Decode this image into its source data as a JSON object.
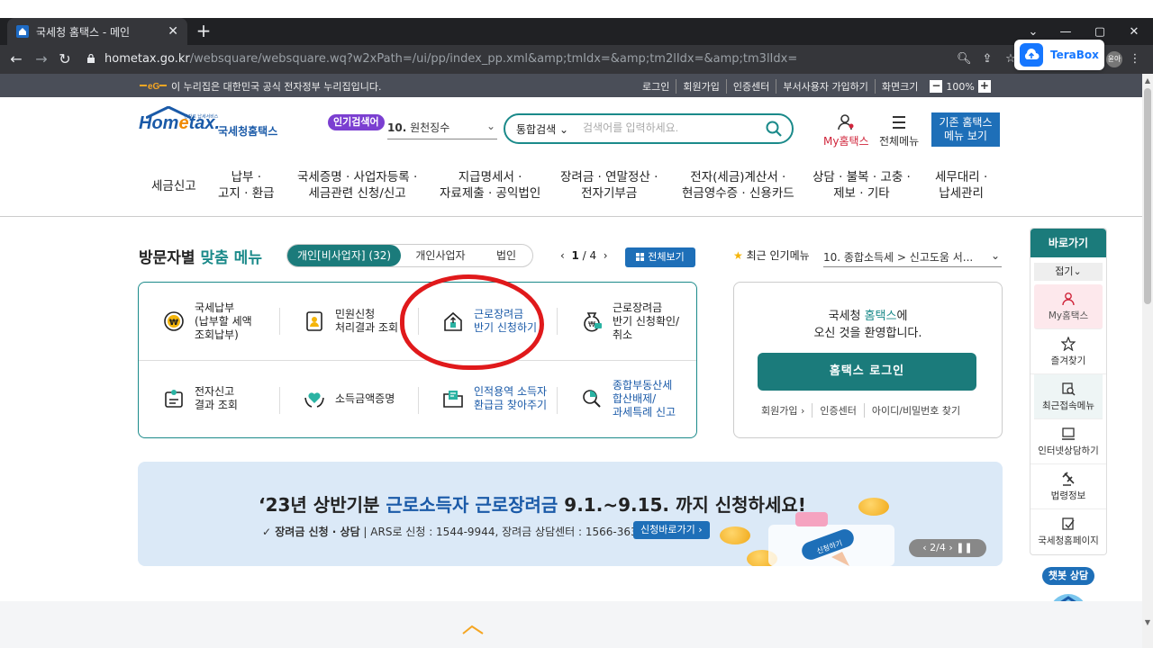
{
  "browser": {
    "tab_title": "국세청 홈택스 - 메인",
    "url_host": "hometax.go.kr",
    "url_path": "/websquare/websquare.wq?w2xPath=/ui/pp/index_pp.xml&amp;tmIdx=&amp;tm2lIdx=&amp;tm3lIdx=",
    "extension_label": "TeraBox",
    "profile_initials": "윤아"
  },
  "govbar": {
    "notice": "이 누리집은 대한민국 공식 전자정부 누리집입니다.",
    "links": [
      "로그인",
      "회원가입",
      "인증센터",
      "부서사용자 가입하기",
      "화면크기"
    ],
    "zoom": "100%",
    "zoom_minus": "−",
    "zoom_plus": "+"
  },
  "header": {
    "logo_tagline": "전자로 납세서비스",
    "logo_kr": "국세청홈택스",
    "popular_badge": "인기검색어",
    "popular_num": "10.",
    "popular_term": "원천징수",
    "search_scope": "통합검색",
    "search_placeholder": "검색어를 입력하세요.",
    "my_hometax": "My홈택스",
    "all_menu": "전체메뉴",
    "old_menu": "기존 홈택스\n메뉴 보기"
  },
  "gnb": [
    "세금신고",
    "납부 ·\n고지 · 환급",
    "국세증명 · 사업자등록 ·\n세금관련 신청/신고",
    "지급명세서 ·\n자료제출 · 공익법인",
    "장려금 · 연말정산 ·\n전자기부금",
    "전자(세금)계산서 ·\n현금영수증 · 신용카드",
    "상담 · 불복 · 고충 ·\n제보 · 기타",
    "세무대리 ·\n납세관리"
  ],
  "custom_menu": {
    "title_prefix": "방문자별",
    "title_accent": "맞춤 메뉴",
    "segments": [
      "개인[비사업자] (32)",
      "개인사업자",
      "법인"
    ],
    "page_current": "1",
    "page_total": "/ 4",
    "all_view": "전체보기",
    "items": [
      "국세납부\n(납부할 세액\n조회납부)",
      "민원신청\n처리결과 조회",
      "근로장려금\n반기 신청하기",
      "근로장려금\n반기 신청확인/\n취소",
      "전자신고\n결과 조회",
      "소득금액증명",
      "인적용역 소득자\n환급금 찾아주기",
      "종합부동산세\n합산배제/\n과세특례 신고"
    ]
  },
  "popular_menu": {
    "label": "최근 인기메뉴",
    "current": "10. 종합소득세 > 신고도움 서..."
  },
  "login_box": {
    "welcome_1": "국세청 ",
    "welcome_hl": "홈택스",
    "welcome_2": "에\n오신 것을 환영합니다.",
    "login_button": "홈택스 로그인",
    "links": [
      "회원가입 ›",
      "인증센터",
      "아이디/비밀번호 찾기"
    ]
  },
  "banner": {
    "title_1": "‘23년 상반기분 ",
    "title_hl": "근로소득자 근로장려금",
    "title_2": " 9.1.~9.15. 까지 신청하세요!",
    "sub_bold": "✓ 장려금 신청 · 상담",
    "sub_rest": " | ARS로 신청 : 1544-9944, 장려금 상담센터 : 1566-3636",
    "button": "신청바로가기 ›",
    "pager": "‹  2/4  ›  ❚❚",
    "phone_label": "신청하기"
  },
  "quick": {
    "title": "바로가기",
    "fold": "접기",
    "items": [
      "My홈택스",
      "즐겨찾기",
      "최근접속메뉴",
      "인터넷상담하기",
      "법령정보",
      "국세청홈페이지"
    ]
  },
  "chatbot": "챗봇 상담"
}
